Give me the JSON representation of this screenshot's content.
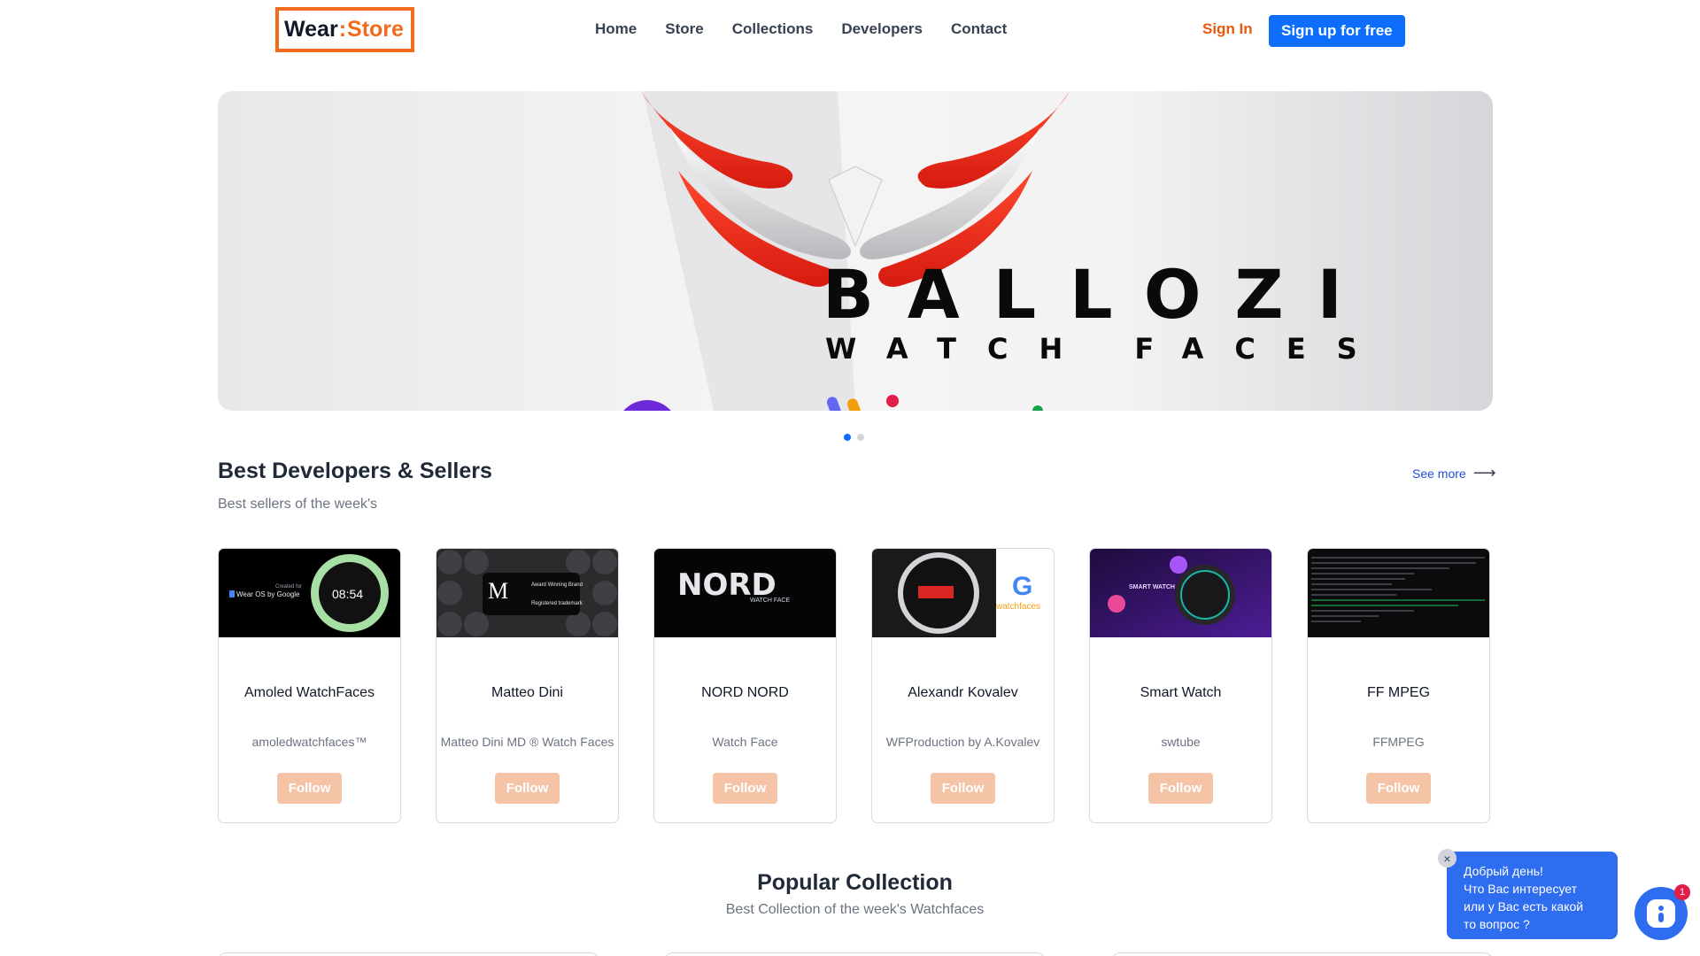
{
  "header": {
    "logo_left": "Wear",
    "logo_colon": ":",
    "logo_right": "Store",
    "nav": [
      "Home",
      "Store",
      "Collections",
      "Developers",
      "Contact"
    ],
    "sign_in": "Sign In",
    "sign_up": "Sign up for free"
  },
  "banner": {
    "brand": "BALLOZI",
    "subtitle": "WATCH FACES",
    "slides": 2,
    "active_slide": 1
  },
  "developers": {
    "title": "Best Developers & Sellers",
    "subtitle": "Best sellers of the week's",
    "see_more": "See more",
    "cards": [
      {
        "name": "Amoled WatchFaces",
        "handle": "amoledwatchfaces™",
        "follow": "Follow",
        "thumb_text": "08:54",
        "thumb_caption": "Wear OS by Google",
        "thumb_caption2": "Created for"
      },
      {
        "name": "Matteo Dini",
        "handle": "Matteo Dini MD ® Watch Faces",
        "follow": "Follow",
        "thumb_text": "M",
        "thumb_caption": "Award Winning Brand",
        "thumb_caption2": "Registered trademark"
      },
      {
        "name": "NORD NORD",
        "handle": "Watch Face",
        "follow": "Follow",
        "thumb_text": "NORD",
        "thumb_caption": "WATCH FACE"
      },
      {
        "name": "Alexandr Kovalev",
        "handle": "WFProduction by A.Kovalev",
        "follow": "Follow",
        "thumb_text": "G",
        "thumb_caption": "watchfaces"
      },
      {
        "name": "Smart Watch",
        "handle": "swtube",
        "follow": "Follow",
        "thumb_text": "SMART WATCH"
      },
      {
        "name": "FF MPEG",
        "handle": "FFMPEG",
        "follow": "Follow"
      }
    ]
  },
  "collection": {
    "title": "Popular Collection",
    "subtitle": "Best Collection of the week's Watchfaces"
  },
  "chat": {
    "lines": [
      "Добрый день!",
      "Что Вас интересует",
      "или у Вас есть какой",
      "то вопрос ?"
    ],
    "close": "×",
    "badge": "1"
  },
  "colors": {
    "accent": "#f26b1d",
    "primary": "#0d6efd",
    "follow_bg": "#f5c3a6",
    "chat": "#2f6df0"
  }
}
